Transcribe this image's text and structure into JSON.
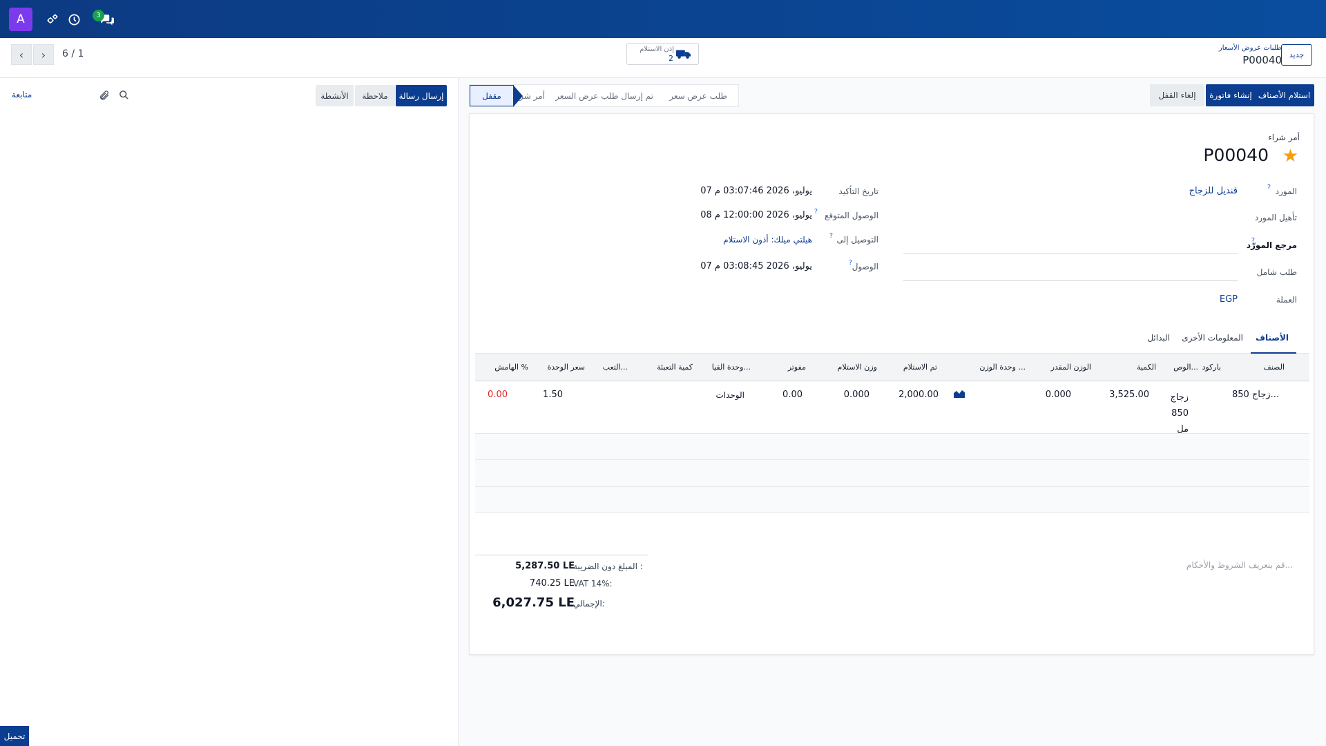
{
  "navbar": {
    "avatar_letter": "A",
    "messages_badge": "3",
    "icons": [
      "gear-icon",
      "clock-icon",
      "chat-icon"
    ]
  },
  "control": {
    "pager": "6 / 1",
    "breadcrumb_parent": "طلبات عروض الأسعار",
    "breadcrumb_current": "P00040",
    "new_button": "جديد",
    "smart_button_title": "إذن الاستلام",
    "smart_button_count": "2"
  },
  "chatter": {
    "send_message": "إرسال رسالة",
    "log_note": "ملاحظة",
    "activities": "الأنشطة",
    "follow": "متابعة",
    "upload": "تحميل"
  },
  "actions": {
    "receive": "استلام الأصناف",
    "create_bill": "إنشاء فاتورة",
    "unlock": "إلغاء القفل"
  },
  "statusbar": {
    "stages": [
      "طلب عرض سعر",
      "تم إرسال طلب عرض السعر",
      "أمر شراء",
      "مقفل"
    ]
  },
  "form": {
    "record_type": "أمر شراء",
    "record_name": "P00040",
    "vendor_label": "المورد",
    "vendor_value": "قنديل للزجاج",
    "vendor_qual_label": "تأهيل المورد",
    "vendor_ref_label": "مرجع المورّد",
    "blanket_label": "طلب شامل",
    "currency_label": "العملة",
    "currency_value": "EGP",
    "confirm_date_label": "تاريخ التأكيد",
    "confirm_date_value": "07 يوليو، 2026 03:07:46 م",
    "expected_label": "الوصول المتوقع",
    "expected_value": "08 يوليو، 2026 12:00:00 م",
    "deliver_to_label": "التوصيل إلى",
    "deliver_to_value": "هيلتي ميلك: أذون الاستلام",
    "arrival_label": "الوصول",
    "arrival_value": "07 يوليو، 2026 03:08:45 م"
  },
  "tabs": [
    "الأصناف",
    "المعلومات الأخرى",
    "البدائل"
  ],
  "table": {
    "headers": [
      "الصنف",
      "باركود",
      "الوص...",
      "الكمية",
      "الوزن المقدر",
      "وحدة الوزن ...",
      "تم الاستلام",
      "وزن الاستلام",
      "مفوتر",
      "وحدة القيا...",
      "كمية التعبئة",
      "التعب...",
      "سعر الوحدة",
      "الهامش %"
    ],
    "rows": [
      {
        "product": "زجاج 850...",
        "description": [
          "زجاج",
          "850",
          "مل"
        ],
        "quantity": "3,525.00",
        "est_weight": "0.000",
        "received": "2,000.00",
        "received_weight": "0.000",
        "billed": "0.00",
        "uom": "الوحدات",
        "unit_price": "1.50",
        "margin": "0.00"
      }
    ]
  },
  "totals": {
    "untaxed_label": "المبلغ دون الضريبة :",
    "untaxed_value": "5,287.50 LE",
    "vat_label": "VAT 14%:",
    "vat_value": "740.25 LE",
    "total_label": "الإجمالي:",
    "total_value": "6,027.75 LE"
  },
  "terms_placeholder": "قم بتعريف الشروط والأحكام..."
}
